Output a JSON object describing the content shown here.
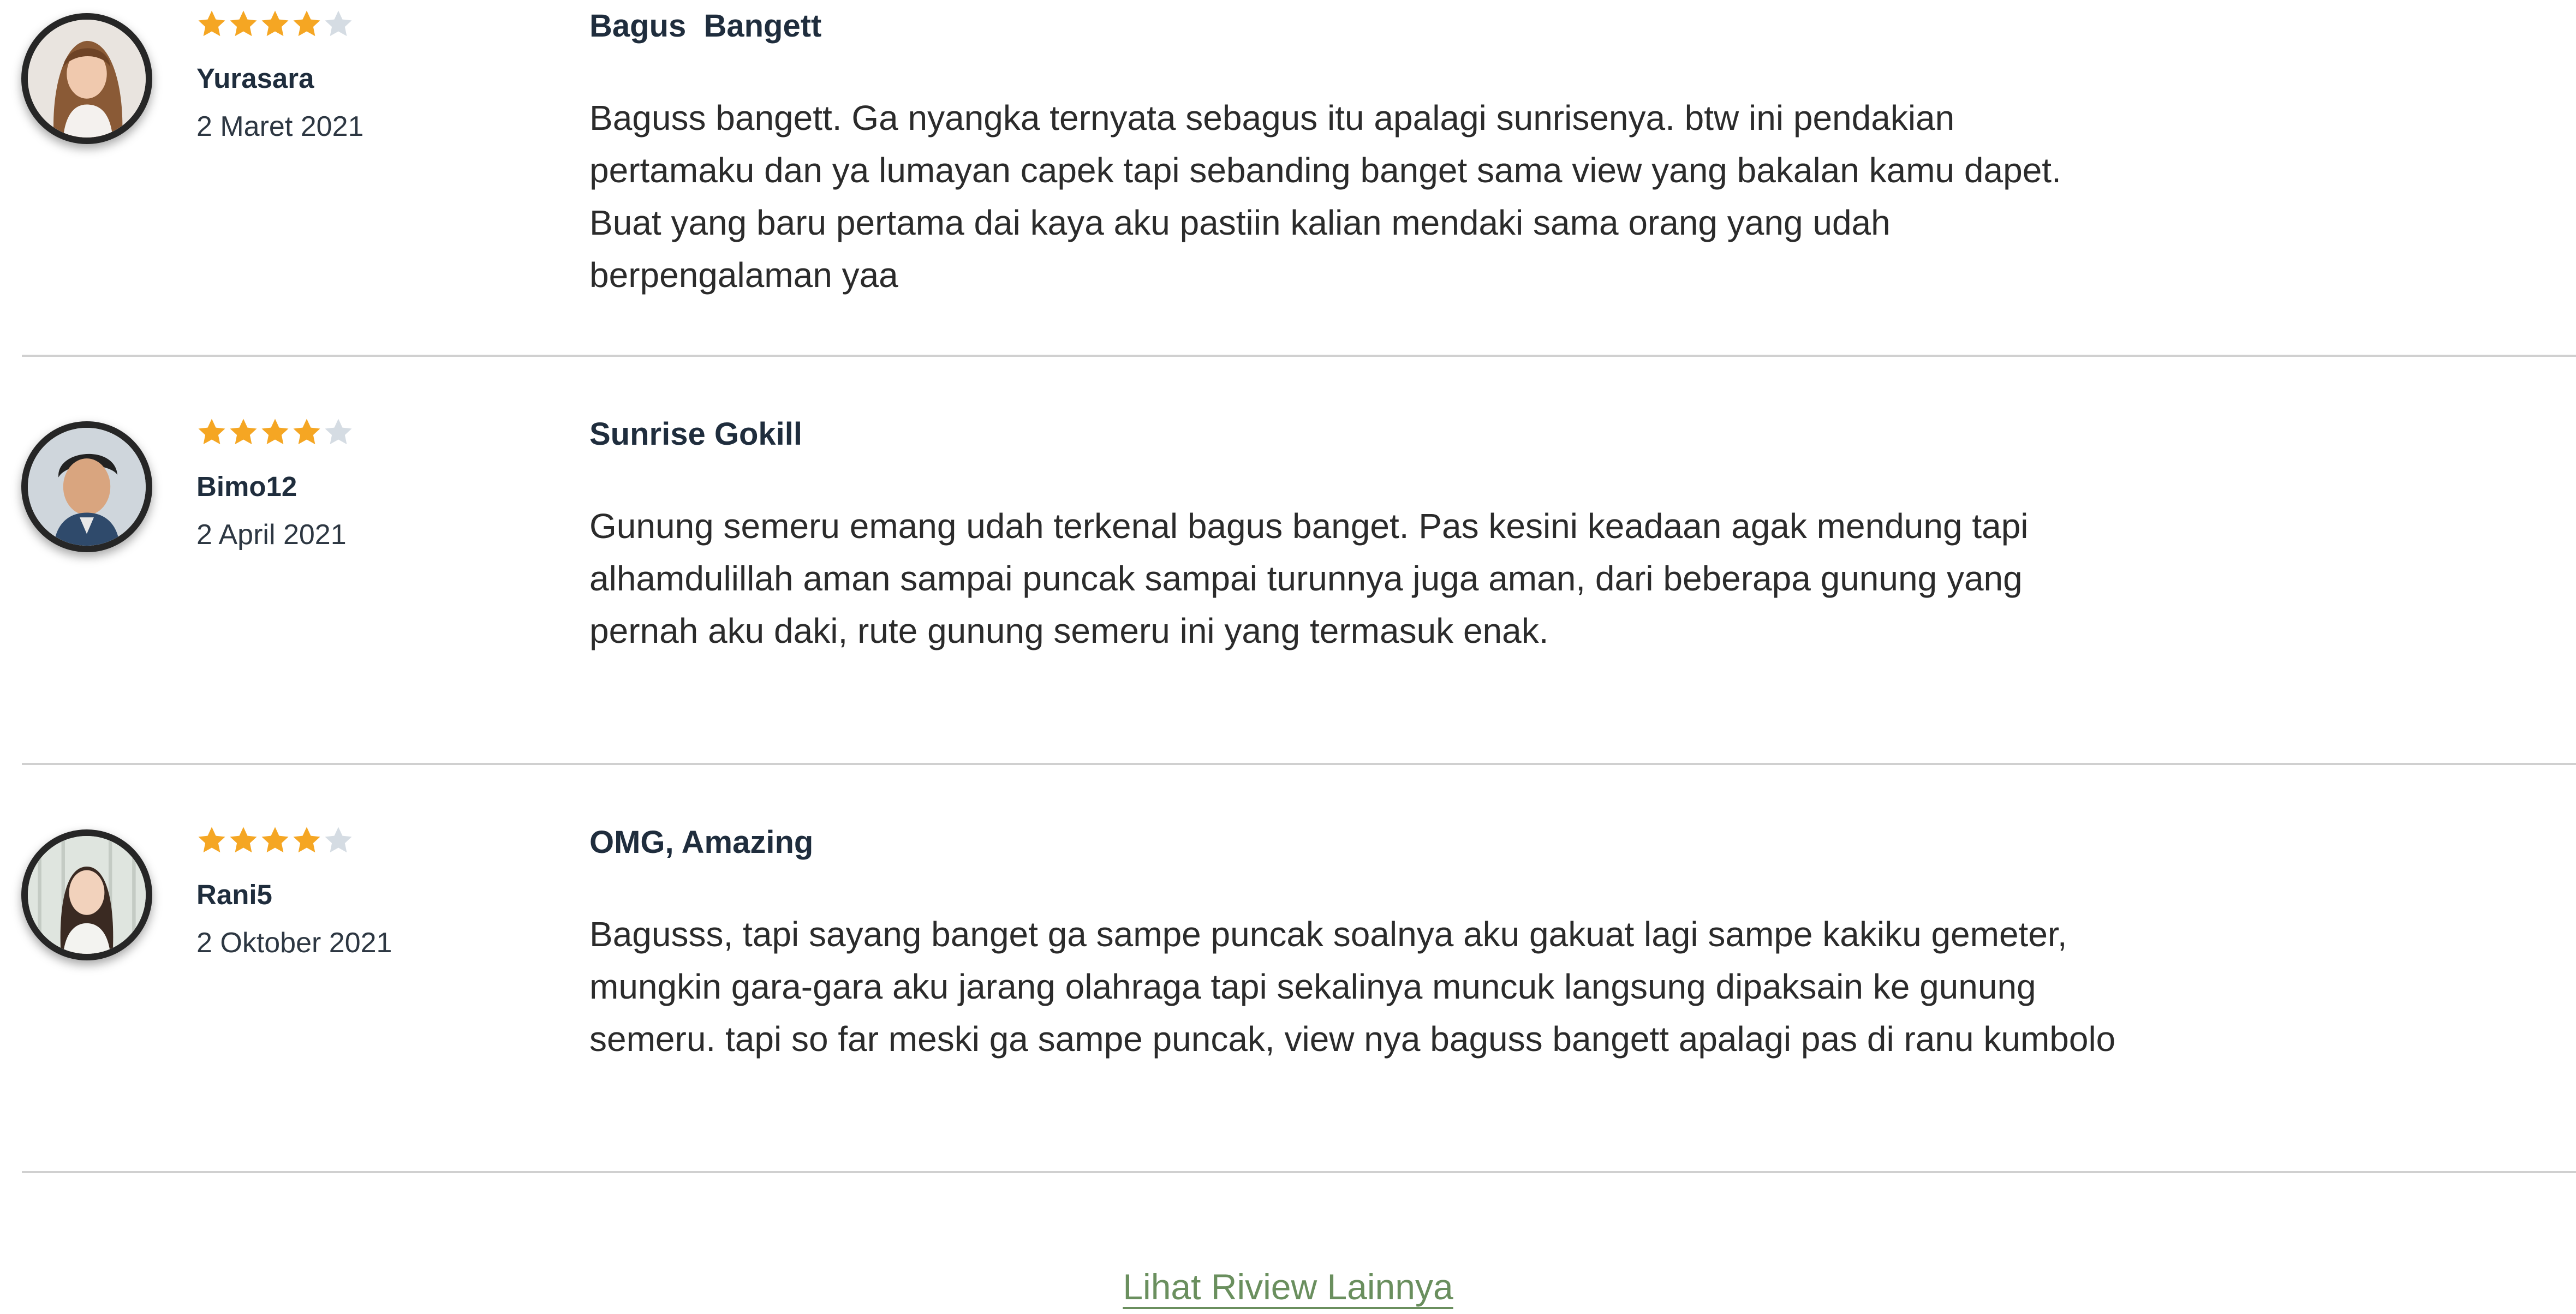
{
  "reviews": [
    {
      "username": "Yurasara",
      "date": "2 Maret 2021",
      "rating": 4,
      "max_rating": 5,
      "title": "Bagus  Bangett",
      "body": "Baguss bangett. Ga nyangka ternyata sebagus itu apalagi sunrisenya. btw ini pendakian pertamaku dan ya lumayan capek tapi sebanding banget sama view yang bakalan kamu dapet. Buat yang baru pertama dai kaya aku pastiin kalian mendaki sama orang yang udah berpengalaman yaa"
    },
    {
      "username": "Bimo12",
      "date": "2 April 2021",
      "rating": 4,
      "max_rating": 5,
      "title": "Sunrise Gokill",
      "body": "Gunung semeru emang udah terkenal bagus banget. Pas kesini keadaan agak mendung tapi alhamdulillah aman sampai puncak sampai turunnya juga aman, dari beberapa gunung yang pernah aku daki, rute gunung semeru ini yang termasuk enak."
    },
    {
      "username": "Rani5",
      "date": "2 Oktober 2021",
      "rating": 4,
      "max_rating": 5,
      "title": "OMG, Amazing",
      "body": "Bagusss, tapi sayang banget ga sampe puncak soalnya aku gakuat lagi sampe kakiku gemeter, mungkin gara-gara aku jarang olahraga tapi sekalinya muncuk langsung dipaksain ke gunung semeru. tapi so far meski ga sampe puncak, view nya baguss bangett apalagi pas di ranu kumbolo"
    }
  ],
  "more_link": "Lihat Riview Lainnya",
  "colors": {
    "star_filled": "#f5a623",
    "star_empty": "#d5dce3",
    "link": "#6a8f5e",
    "divider": "#d0d0d0",
    "avatar_border": "#262626"
  },
  "icons": {
    "star": "star-icon"
  }
}
